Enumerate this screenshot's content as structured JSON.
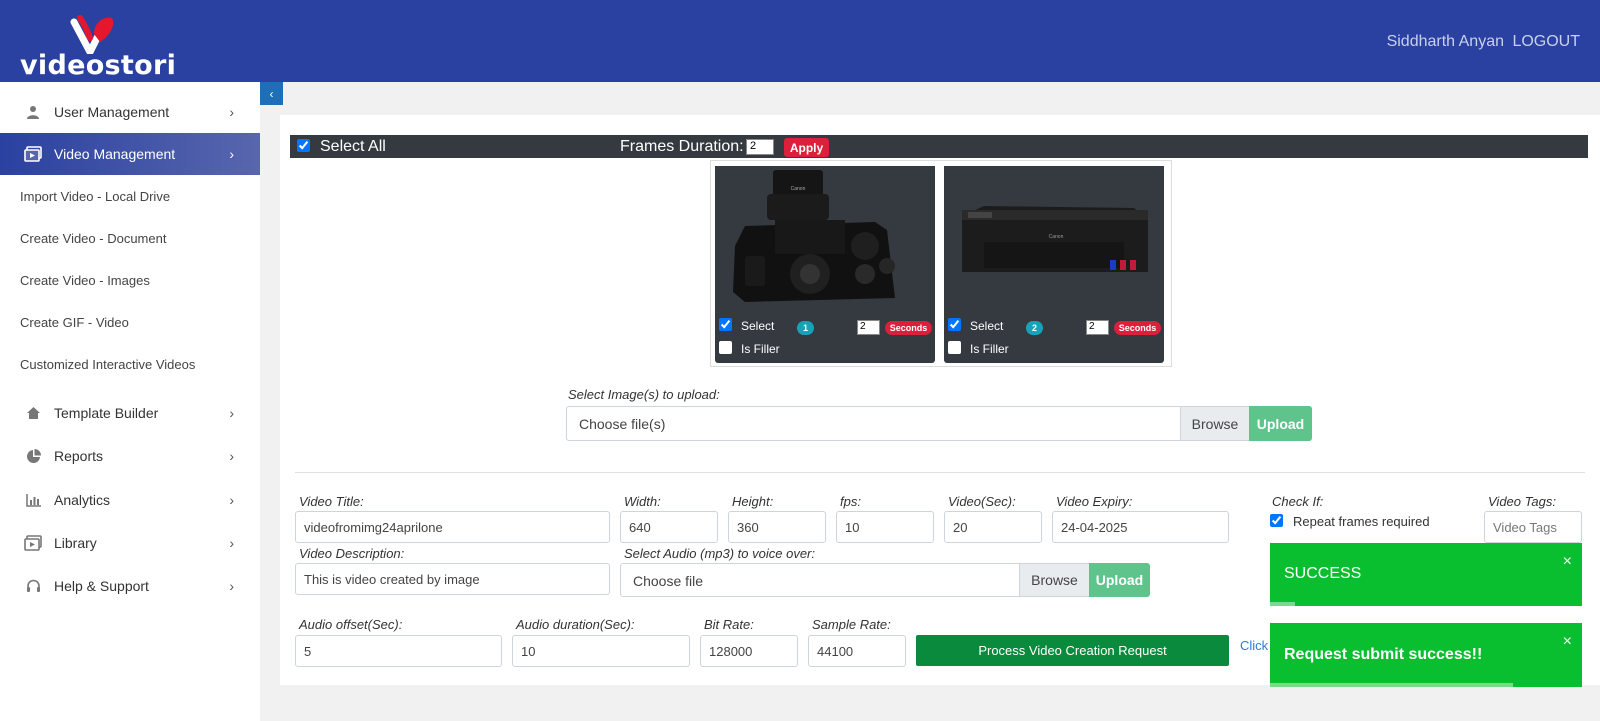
{
  "header": {
    "logo_text": "videostori",
    "user_name": "Siddharth Anyan",
    "logout_label": "LOGOUT"
  },
  "sidebar": {
    "items": [
      {
        "label": "User Management",
        "icon": "user-icon"
      },
      {
        "label": "Video Management",
        "icon": "video-library-icon",
        "active": true
      },
      {
        "label": "Template Builder",
        "icon": "home-icon"
      },
      {
        "label": "Reports",
        "icon": "pie-chart-icon"
      },
      {
        "label": "Analytics",
        "icon": "bar-chart-icon"
      },
      {
        "label": "Library",
        "icon": "library-icon"
      },
      {
        "label": "Help & Support",
        "icon": "headset-icon"
      }
    ],
    "sub_items": [
      "Import Video - Local Drive",
      "Create Video - Document",
      "Create Video - Images",
      "Create GIF - Video",
      "Customized Interactive Videos"
    ]
  },
  "toolbar": {
    "select_all_label": "Select All",
    "select_all_checked": true,
    "frames_duration_label": "Frames Duration:",
    "frames_duration_value": "2",
    "apply_label": "Apply"
  },
  "frames": [
    {
      "select_label": "Select",
      "selected": true,
      "index": "1",
      "seconds_value": "2",
      "seconds_label": "Seconds",
      "filler_label": "Is Filler",
      "filler": false,
      "image": "camera"
    },
    {
      "select_label": "Select",
      "selected": true,
      "index": "2",
      "seconds_value": "2",
      "seconds_label": "Seconds",
      "filler_label": "Is Filler",
      "filler": false,
      "image": "printer"
    }
  ],
  "image_upload": {
    "label": "Select Image(s) to upload:",
    "placeholder": "Choose file(s)",
    "browse_label": "Browse",
    "upload_label": "Upload"
  },
  "form": {
    "video_title": {
      "label": "Video Title:",
      "value": "videofromimg24aprilone"
    },
    "width": {
      "label": "Width:",
      "value": "640"
    },
    "height": {
      "label": "Height:",
      "value": "360"
    },
    "fps": {
      "label": "fps:",
      "value": "10"
    },
    "video_sec": {
      "label": "Video(Sec):",
      "value": "20"
    },
    "video_expiry": {
      "label": "Video Expiry:",
      "value": "24-04-2025"
    },
    "check_if": {
      "label": "Check If:",
      "repeat_label": "Repeat frames required",
      "repeat_checked": true
    },
    "video_tags": {
      "label": "Video Tags:",
      "placeholder": "Video Tags"
    },
    "video_description": {
      "label": "Video Description:",
      "value": "This is video created by image"
    },
    "audio": {
      "label": "Select Audio (mp3) to voice over:",
      "placeholder": "Choose file",
      "browse_label": "Browse",
      "upload_label": "Upload"
    },
    "audio_offset": {
      "label": "Audio offset(Sec):",
      "value": "5"
    },
    "audio_duration": {
      "label": "Audio duration(Sec):",
      "value": "10"
    },
    "bit_rate": {
      "label": "Bit Rate:",
      "value": "128000"
    },
    "sample_rate": {
      "label": "Sample Rate:",
      "value": "44100"
    },
    "process_label": "Process Video Creation Request",
    "click_link": "Click"
  },
  "toasts": [
    {
      "message": "SUCCESS",
      "close": "×",
      "progress": 0.08
    },
    {
      "message": "Request submit success!!",
      "close": "×",
      "progress": 0.78
    }
  ],
  "colors": {
    "header": "#2a41a1",
    "apply": "#dc1f3b",
    "process": "#0a8a3c",
    "upload": "#5fc48c",
    "toast": "#0abf2f"
  }
}
